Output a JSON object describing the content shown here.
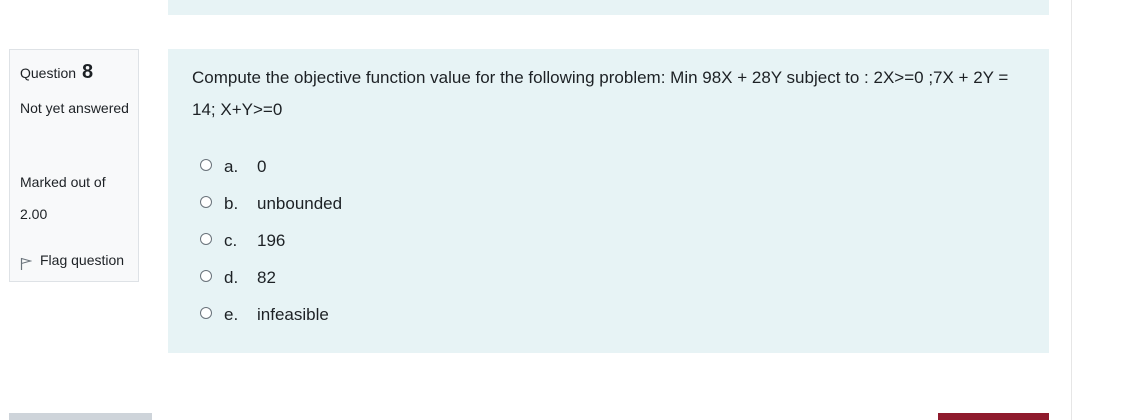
{
  "info": {
    "question_label": "Question",
    "question_number": "8",
    "state": "Not yet answered",
    "grade": "Marked out of 2.00",
    "flag_label": "Flag question"
  },
  "question": {
    "text": "Compute the objective function value for the following problem: Min 98X + 28Y subject to : 2X>=0 ;7X + 2Y = 14; X+Y>=0",
    "answers": [
      {
        "letter": "a.",
        "text": "0"
      },
      {
        "letter": "b.",
        "text": "unbounded"
      },
      {
        "letter": "c.",
        "text": "196"
      },
      {
        "letter": "d.",
        "text": "82"
      },
      {
        "letter": "e.",
        "text": "infeasible"
      }
    ]
  },
  "colors": {
    "content_bg": "#e7f3f5",
    "info_bg": "#f8f9fa",
    "next_button": "#8f1b2d",
    "prev_button": "#ced4da"
  },
  "icons": {
    "flag": "flag-icon",
    "radio": "radio-unchecked-icon"
  }
}
